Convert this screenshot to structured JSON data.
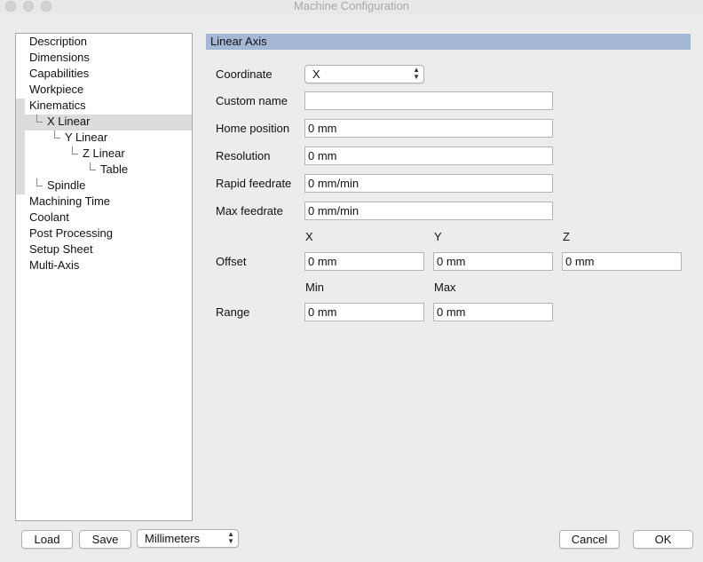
{
  "window": {
    "title": "Machine Configuration"
  },
  "tree": {
    "items": [
      {
        "label": "Description"
      },
      {
        "label": "Dimensions"
      },
      {
        "label": "Capabilities"
      },
      {
        "label": "Workpiece"
      },
      {
        "label": "Kinematics"
      },
      {
        "label": "X Linear"
      },
      {
        "label": "Y Linear"
      },
      {
        "label": "Z Linear"
      },
      {
        "label": "Table"
      },
      {
        "label": "Spindle"
      },
      {
        "label": "Machining Time"
      },
      {
        "label": "Coolant"
      },
      {
        "label": "Post Processing"
      },
      {
        "label": "Setup Sheet"
      },
      {
        "label": "Multi-Axis"
      }
    ],
    "selected": "X Linear"
  },
  "panel": {
    "header": "Linear Axis",
    "coordinate": {
      "label": "Coordinate",
      "value": "X"
    },
    "custom_name": {
      "label": "Custom name",
      "value": ""
    },
    "home_position": {
      "label": "Home position",
      "value": "0 mm"
    },
    "resolution": {
      "label": "Resolution",
      "value": "0 mm"
    },
    "rapid_feedrate": {
      "label": "Rapid feedrate",
      "value": "0 mm/min"
    },
    "max_feedrate": {
      "label": "Max feedrate",
      "value": "0 mm/min"
    },
    "offset": {
      "label": "Offset",
      "col_x": "X",
      "col_y": "Y",
      "col_z": "Z",
      "x": "0 mm",
      "y": "0 mm",
      "z": "0 mm"
    },
    "range": {
      "label": "Range",
      "col_min": "Min",
      "col_max": "Max",
      "min": "0 mm",
      "max": "0 mm"
    }
  },
  "footer": {
    "load_label": "Load",
    "save_label": "Save",
    "units_value": "Millimeters",
    "cancel_label": "Cancel",
    "ok_label": "OK"
  }
}
